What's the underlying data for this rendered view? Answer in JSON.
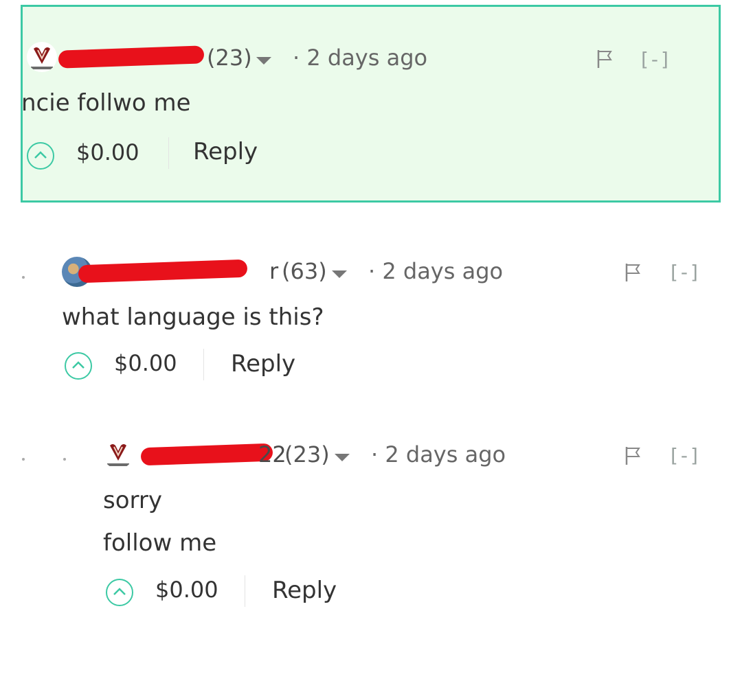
{
  "comments": [
    {
      "username_suffix": "",
      "reputation": "(23)",
      "timestamp": "· 2 days ago",
      "collapse_label": "[-]",
      "body": [
        "ncie follwo me"
      ],
      "payout": "$0.00",
      "reply_label": "Reply",
      "highlighted": true
    },
    {
      "username_suffix": "r",
      "reputation": "(63)",
      "timestamp": "· 2 days ago",
      "collapse_label": "[-]",
      "body": [
        "what language is this?"
      ],
      "payout": "$0.00",
      "reply_label": "Reply",
      "highlighted": false
    },
    {
      "username_suffix": "22",
      "reputation": "(23)",
      "timestamp": "· 2 days ago",
      "collapse_label": "[-]",
      "body": [
        "sorry",
        "follow me"
      ],
      "payout": "$0.00",
      "reply_label": "Reply",
      "highlighted": false
    }
  ],
  "colors": {
    "accent": "#3cc9a4",
    "highlight_bg": "#ebfbeb",
    "redaction": "#e8111b"
  },
  "icons": {
    "upvote": "chevron-up-circle-icon",
    "flag": "flag-icon",
    "dropdown": "caret-down-icon"
  }
}
